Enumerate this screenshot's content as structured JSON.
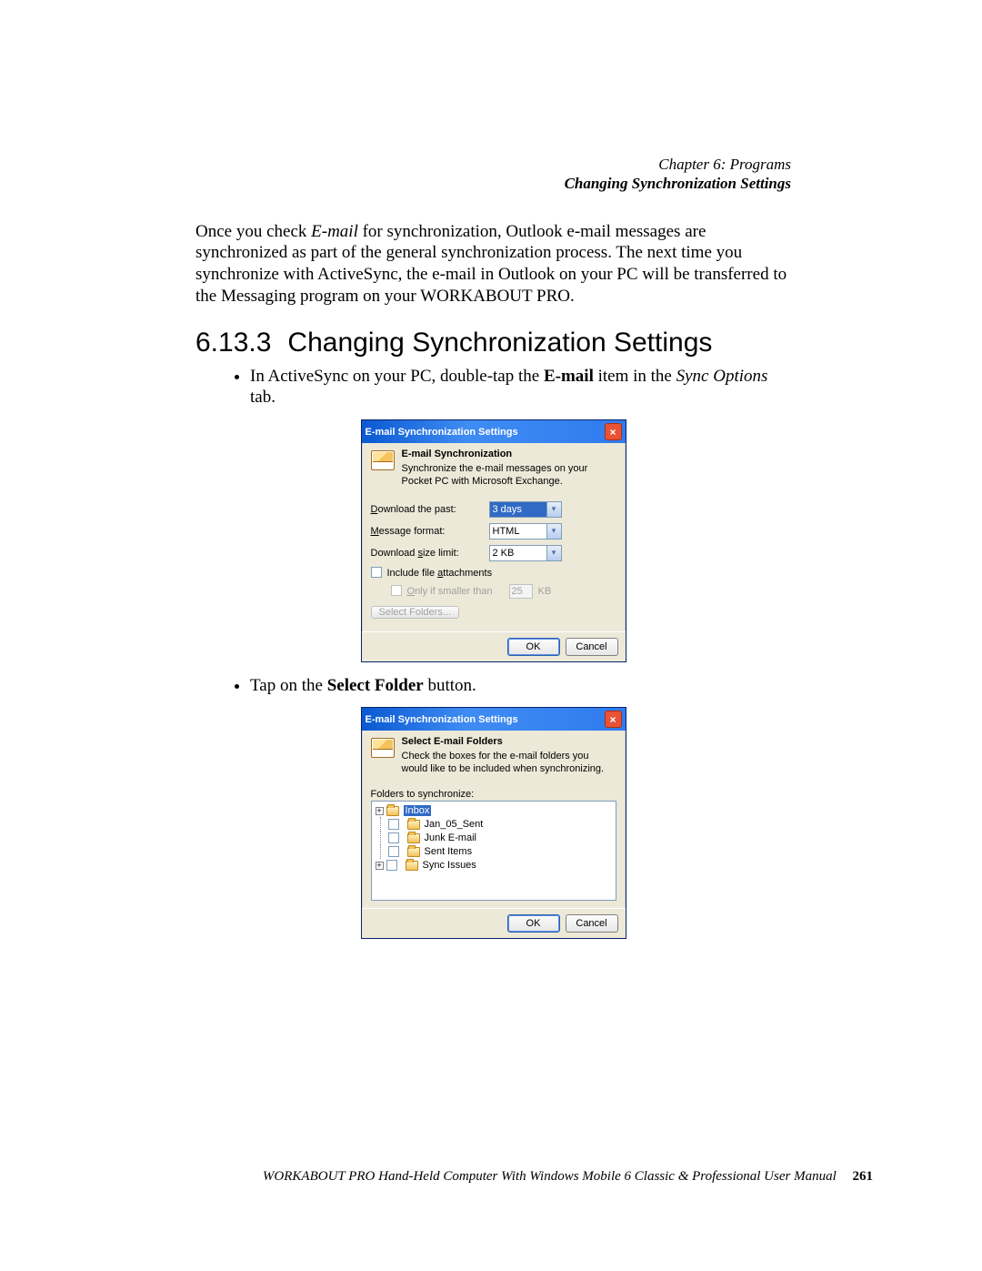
{
  "header": {
    "chapter": "Chapter 6:  Programs",
    "section": "Changing Synchronization Settings"
  },
  "intro": {
    "p1_a": "Once you check ",
    "p1_em": "E-mail",
    "p1_b": " for synchronization, Outlook e-mail messages are synchronized as part of the general synchronization process. The next time you synchronize with ActiveSync, the e-mail in Outlook on your PC will be transferred to the Messaging program on your WORKABOUT PRO."
  },
  "section_title": {
    "num": "6.13.3",
    "txt": "Changing Synchronization Settings"
  },
  "step1": {
    "a": "In ActiveSync on your PC, double-tap the ",
    "b": "E-mail",
    "c": " item in the ",
    "d": "Sync Options",
    "e": " tab."
  },
  "step2": {
    "a": "Tap on the ",
    "b": "Select Folder",
    "c": " button."
  },
  "dlg1": {
    "title": "E-mail Synchronization Settings",
    "h1": "E-mail Synchronization",
    "h2": "Synchronize the e-mail messages on your Pocket PC with Microsoft Exchange.",
    "lbl_past_a": "D",
    "lbl_past_b": "ownload the past:",
    "val_past": "3 days",
    "lbl_fmt_a": "M",
    "lbl_fmt_b": "essage format:",
    "val_fmt": "HTML",
    "lbl_size_a": "Download ",
    "lbl_size_b": "s",
    "lbl_size_c": "ize limit:",
    "val_size": "2 KB",
    "chk_att_a": "Include file ",
    "chk_att_b": "a",
    "chk_att_c": "ttachments",
    "chk_only_a": "O",
    "chk_only_b": "nly if smaller than",
    "only_val": "25",
    "only_unit": "KB",
    "btn_sel_a": "Select ",
    "btn_sel_b": "F",
    "btn_sel_c": "olders...",
    "ok": "OK",
    "cancel": "Cancel"
  },
  "dlg2": {
    "title": "E-mail Synchronization Settings",
    "h1": "Select E-mail Folders",
    "h2": "Check the boxes for the e-mail folders you would like to be included when synchronizing.",
    "lbl_folders": "Folders to synchronize:",
    "tree": {
      "inbox": "Inbox",
      "jan": "Jan_05_Sent",
      "junk": "Junk E-mail",
      "sent": "Sent Items",
      "sync": "Sync Issues"
    },
    "ok": "OK",
    "cancel": "Cancel"
  },
  "footer": {
    "txt": "WORKABOUT PRO Hand-Held Computer With Windows Mobile 6 Classic & Professional User Manual",
    "page": "261"
  }
}
